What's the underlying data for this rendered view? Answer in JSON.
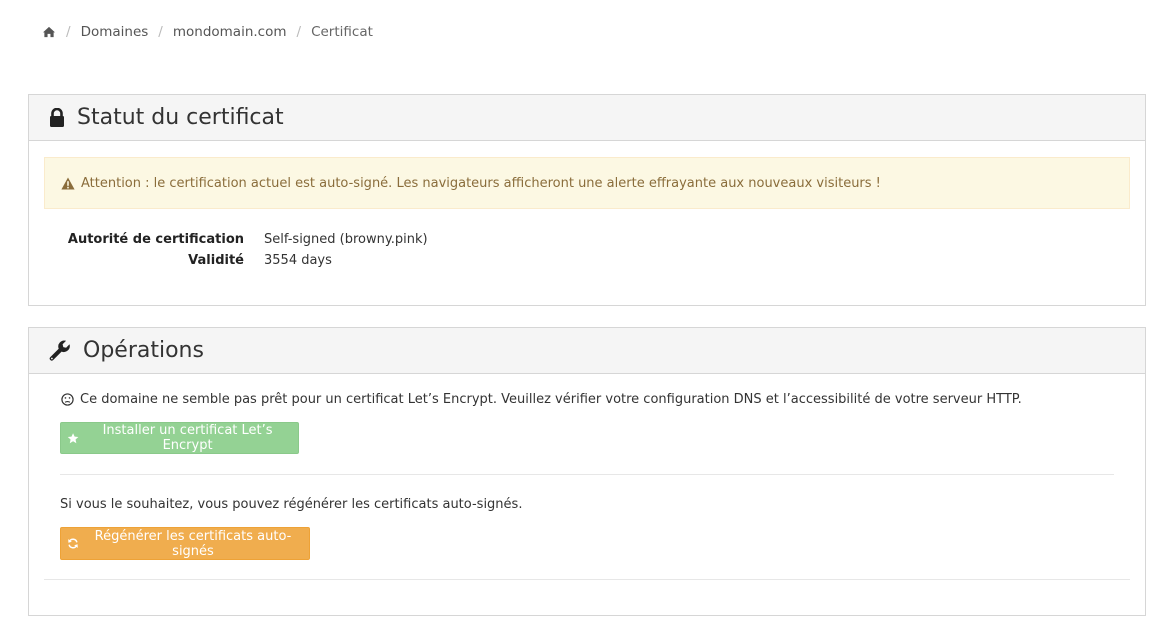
{
  "breadcrumb": {
    "items": [
      "Domaines",
      "mondomain.com"
    ],
    "active": "Certificat"
  },
  "status_panel": {
    "title": "Statut du certificat",
    "alert": "Attention : le certification actuel est auto-signé. Les navigateurs afficheront une alerte effrayante aux nouveaux visiteurs !",
    "fields": [
      {
        "label": "Autorité de certification",
        "value": "Self-signed (browny.pink)"
      },
      {
        "label": "Validité",
        "value": "3554 days"
      }
    ]
  },
  "operations_panel": {
    "title": "Opérations",
    "message": "Ce domaine ne semble pas prêt pour un certificat Let’s Encrypt. Veuillez vérifier votre configuration DNS et l’accessibilité de votre serveur HTTP.",
    "install_button": "Installer un certificat Let’s Encrypt",
    "regen_text": "Si vous le souhaitez, vous pouvez régénérer les certificats auto-signés.",
    "regen_button": "Régénérer les certificats auto-signés"
  },
  "icons": {
    "home": "home-icon",
    "lock": "lock-icon",
    "warning": "warning-icon",
    "wrench": "wrench-icon",
    "frown": "frown-icon",
    "star": "star-icon",
    "refresh": "refresh-icon"
  },
  "colors": {
    "alert_bg": "#fcf8e3",
    "alert_text": "#8a6d3b",
    "success_btn": "#8fd08f",
    "warning_btn": "#f0ad4e"
  }
}
